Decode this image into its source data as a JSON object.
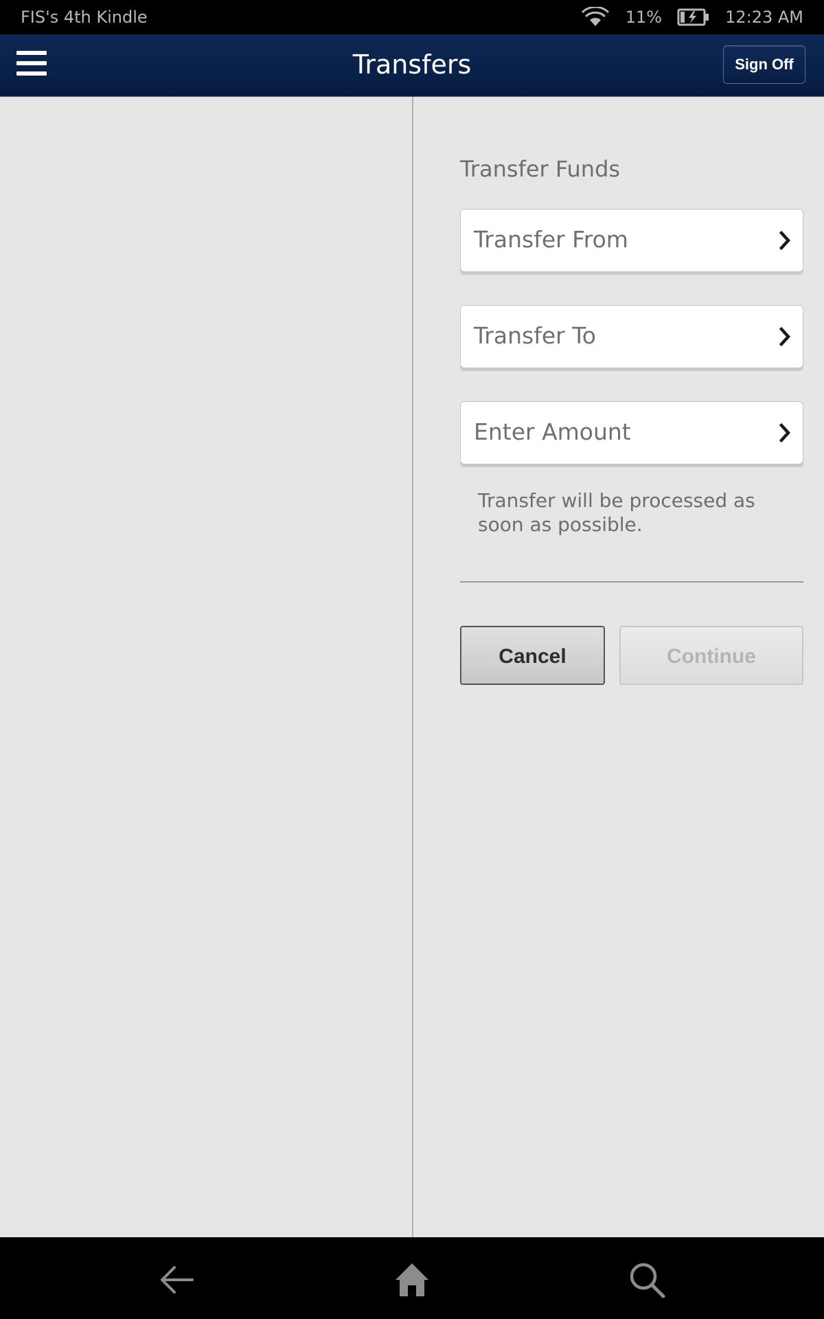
{
  "status_bar": {
    "device_name": "FIS's 4th Kindle",
    "battery": "11%",
    "time": "12:23 AM",
    "icons": [
      "wifi-icon",
      "battery-charging-icon"
    ]
  },
  "header": {
    "title": "Transfers",
    "sign_off_label": "Sign Off",
    "menu_icon": "hamburger-menu-icon"
  },
  "form": {
    "section_title": "Transfer Funds",
    "fields": [
      {
        "label": "Transfer From",
        "icon": "chevron-right-icon"
      },
      {
        "label": "Transfer To",
        "icon": "chevron-right-icon"
      },
      {
        "label": "Enter Amount",
        "icon": "chevron-right-icon"
      }
    ],
    "note": "Transfer will be processed as soon as possible.",
    "cancel_label": "Cancel",
    "continue_label": "Continue"
  },
  "nav_bar": {
    "icons": [
      "back-arrow-icon",
      "home-icon",
      "search-icon"
    ]
  },
  "colors": {
    "header_bg": "#0a2249",
    "content_bg": "#e6e6e6",
    "field_bg": "#ffffff",
    "text_gray": "#6e6e6e",
    "disabled_text": "#b5b5b5"
  }
}
